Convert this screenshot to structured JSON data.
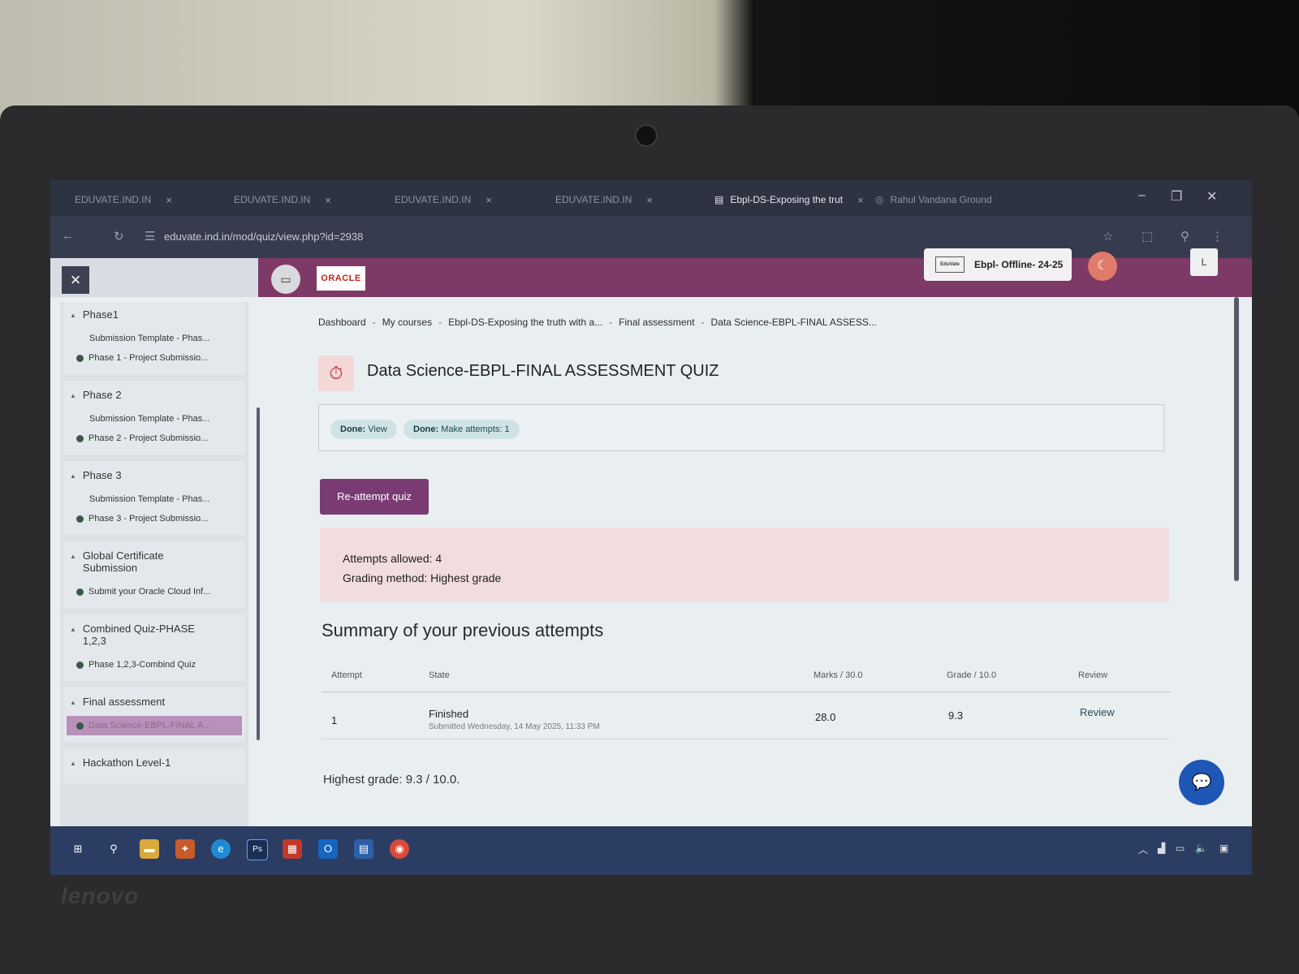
{
  "browser": {
    "tabs": [
      {
        "label": "EDUVATE.IND.IN",
        "active": false
      },
      {
        "label": "EDUVATE.IND.IN",
        "active": false
      },
      {
        "label": "EDUVATE.IND.IN",
        "active": false
      },
      {
        "label": "EDUVATE.IND.IN",
        "active": false
      },
      {
        "label": "Ebpl-DS-Exposing the trut",
        "active": true
      },
      {
        "label": "Rahul Vandana Ground",
        "active": false
      }
    ],
    "url": "eduvate.ind.in/mod/quiz/view.php?id=2938"
  },
  "header": {
    "oracle_label": "ORACLE",
    "course_pill": "Ebpl- Offline- 24-25",
    "course_logo": "EduVate",
    "user_initial": "L"
  },
  "sidebar": {
    "sections": [
      {
        "title": "Phase1",
        "items": [
          {
            "label": "Submission Template - Phas...",
            "done": false
          },
          {
            "label": "Phase 1 - Project Submissio...",
            "done": true
          }
        ]
      },
      {
        "title": "Phase 2",
        "items": [
          {
            "label": "Submission Template - Phas...",
            "done": false
          },
          {
            "label": "Phase 2 - Project Submissio...",
            "done": true
          }
        ]
      },
      {
        "title": "Phase 3",
        "items": [
          {
            "label": "Submission Template - Phas...",
            "done": false
          },
          {
            "label": "Phase 3 - Project Submissio...",
            "done": true
          }
        ]
      },
      {
        "title": "Global Certificate Submission",
        "items": [
          {
            "label": "Submit your Oracle Cloud Inf...",
            "done": true
          }
        ]
      },
      {
        "title": "Combined Quiz-PHASE 1,2,3",
        "items": [
          {
            "label": "Phase 1,2,3-Combind Quiz",
            "done": true
          }
        ]
      },
      {
        "title": "Final assessment",
        "items": [
          {
            "label": "Data Science-EBPL-FINAL A...",
            "done": true,
            "active": true
          }
        ]
      },
      {
        "title": "Hackathon Level-1",
        "items": []
      }
    ]
  },
  "breadcrumbs": [
    "Dashboard",
    "My courses",
    "Ebpl-DS-Exposing the truth with a...",
    "Final assessment",
    "Data Science-EBPL-FINAL ASSESS..."
  ],
  "quiz": {
    "title": "Data Science-EBPL-FINAL ASSESSMENT QUIZ",
    "badges": [
      {
        "label": "Done:",
        "value": "View"
      },
      {
        "label": "Done:",
        "value": "Make attempts: 1"
      }
    ],
    "reattempt_label": "Re-attempt quiz",
    "attempts_allowed": "Attempts allowed: 4",
    "grading_method": "Grading method: Highest grade",
    "summary_title": "Summary of your previous attempts",
    "table": {
      "headers": [
        "Attempt",
        "State",
        "Marks / 30.0",
        "Grade / 10.0",
        "Review"
      ],
      "rows": [
        {
          "attempt": "1",
          "state": "Finished",
          "submitted": "Submitted Wednesday, 14 May 2025, 11:33 PM",
          "marks": "28.0",
          "grade": "9.3",
          "review": "Review"
        }
      ]
    },
    "highest_grade": "Highest grade: 9.3 / 10.0."
  },
  "device": {
    "brand": "lenovo"
  }
}
